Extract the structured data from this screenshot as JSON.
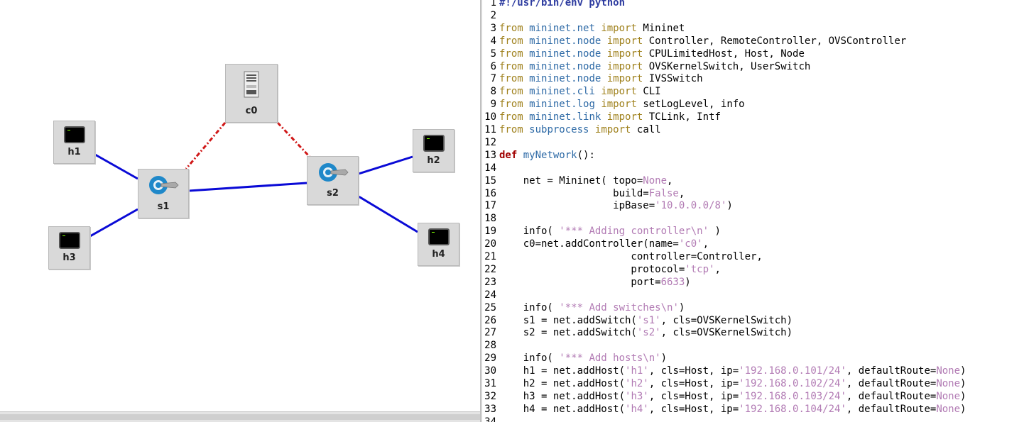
{
  "topology": {
    "nodes": [
      {
        "id": "h1",
        "label": "h1",
        "kind": "host",
        "icon": "terminal-icon"
      },
      {
        "id": "h2",
        "label": "h2",
        "kind": "host",
        "icon": "terminal-icon"
      },
      {
        "id": "h3",
        "label": "h3",
        "kind": "host",
        "icon": "terminal-icon"
      },
      {
        "id": "h4",
        "label": "h4",
        "kind": "host",
        "icon": "terminal-icon"
      },
      {
        "id": "s1",
        "label": "s1",
        "kind": "switch",
        "icon": "switch-icon"
      },
      {
        "id": "s2",
        "label": "s2",
        "kind": "switch",
        "icon": "switch-icon"
      },
      {
        "id": "c0",
        "label": "c0",
        "kind": "controller",
        "icon": "server-icon"
      }
    ],
    "links": [
      {
        "from": "h1",
        "to": "s1",
        "type": "data"
      },
      {
        "from": "h3",
        "to": "s1",
        "type": "data"
      },
      {
        "from": "s1",
        "to": "s2",
        "type": "data"
      },
      {
        "from": "s2",
        "to": "h2",
        "type": "data"
      },
      {
        "from": "s2",
        "to": "h4",
        "type": "data"
      },
      {
        "from": "c0",
        "to": "s1",
        "type": "control"
      },
      {
        "from": "c0",
        "to": "s2",
        "type": "control"
      }
    ],
    "colors": {
      "data_link": "#0a0ad6",
      "control_link": "#d01818",
      "node_bg": "#d9d9d9"
    }
  },
  "editor": {
    "colors": {
      "keyword": "#a0821e",
      "module": "#2e6aa6",
      "string": "#b27bb4",
      "def": "#a00000"
    },
    "lines": [
      {
        "n": "1",
        "t": [
          [
            "shebang",
            "#!/usr/bin/env python"
          ]
        ]
      },
      {
        "n": "2",
        "t": []
      },
      {
        "n": "3",
        "t": [
          [
            "kw",
            "from"
          ],
          [
            "",
            ""
          ],
          [
            "plain",
            " "
          ],
          [
            "mod",
            "mininet.net"
          ],
          [
            "plain",
            " "
          ],
          [
            "kw",
            "import"
          ],
          [
            "plain",
            " Mininet"
          ]
        ]
      },
      {
        "n": "4",
        "t": [
          [
            "kw",
            "from"
          ],
          [
            "plain",
            " "
          ],
          [
            "mod",
            "mininet.node"
          ],
          [
            "plain",
            " "
          ],
          [
            "kw",
            "import"
          ],
          [
            "plain",
            " Controller, RemoteController, OVSController"
          ]
        ]
      },
      {
        "n": "5",
        "t": [
          [
            "kw",
            "from"
          ],
          [
            "plain",
            " "
          ],
          [
            "mod",
            "mininet.node"
          ],
          [
            "plain",
            " "
          ],
          [
            "kw",
            "import"
          ],
          [
            "plain",
            " CPULimitedHost, Host, Node"
          ]
        ]
      },
      {
        "n": "6",
        "t": [
          [
            "kw",
            "from"
          ],
          [
            "plain",
            " "
          ],
          [
            "mod",
            "mininet.node"
          ],
          [
            "plain",
            " "
          ],
          [
            "kw",
            "import"
          ],
          [
            "plain",
            " OVSKernelSwitch, UserSwitch"
          ]
        ]
      },
      {
        "n": "7",
        "t": [
          [
            "kw",
            "from"
          ],
          [
            "plain",
            " "
          ],
          [
            "mod",
            "mininet.node"
          ],
          [
            "plain",
            " "
          ],
          [
            "kw",
            "import"
          ],
          [
            "plain",
            " IVSSwitch"
          ]
        ]
      },
      {
        "n": "8",
        "t": [
          [
            "kw",
            "from"
          ],
          [
            "plain",
            " "
          ],
          [
            "mod",
            "mininet.cli"
          ],
          [
            "plain",
            " "
          ],
          [
            "kw",
            "import"
          ],
          [
            "plain",
            " CLI"
          ]
        ]
      },
      {
        "n": "9",
        "t": [
          [
            "kw",
            "from"
          ],
          [
            "plain",
            " "
          ],
          [
            "mod",
            "mininet.log"
          ],
          [
            "plain",
            " "
          ],
          [
            "kw",
            "import"
          ],
          [
            "plain",
            " setLogLevel, info"
          ]
        ]
      },
      {
        "n": "10",
        "t": [
          [
            "kw",
            "from"
          ],
          [
            "plain",
            " "
          ],
          [
            "mod",
            "mininet.link"
          ],
          [
            "plain",
            " "
          ],
          [
            "kw",
            "import"
          ],
          [
            "plain",
            " TCLink, Intf"
          ]
        ]
      },
      {
        "n": "11",
        "t": [
          [
            "kw",
            "from"
          ],
          [
            "plain",
            " "
          ],
          [
            "mod",
            "subprocess"
          ],
          [
            "plain",
            " "
          ],
          [
            "kw",
            "import"
          ],
          [
            "plain",
            " call"
          ]
        ]
      },
      {
        "n": "12",
        "t": []
      },
      {
        "n": "13",
        "t": [
          [
            "def",
            "def"
          ],
          [
            "plain",
            " "
          ],
          [
            "fn",
            "myNetwork"
          ],
          [
            "plain",
            "():"
          ]
        ]
      },
      {
        "n": "14",
        "t": []
      },
      {
        "n": "15",
        "t": [
          [
            "plain",
            "    net = Mininet( topo="
          ],
          [
            "str",
            "None"
          ],
          [
            "plain",
            ","
          ]
        ]
      },
      {
        "n": "16",
        "t": [
          [
            "plain",
            "                   build="
          ],
          [
            "str",
            "False"
          ],
          [
            "plain",
            ","
          ]
        ]
      },
      {
        "n": "17",
        "t": [
          [
            "plain",
            "                   ipBase="
          ],
          [
            "str",
            "'10.0.0.0/8'"
          ],
          [
            "plain",
            ")"
          ]
        ]
      },
      {
        "n": "18",
        "t": []
      },
      {
        "n": "19",
        "t": [
          [
            "plain",
            "    info( "
          ],
          [
            "str",
            "'*** Adding controller\\n'"
          ],
          [
            "plain",
            " )"
          ]
        ]
      },
      {
        "n": "20",
        "t": [
          [
            "plain",
            "    c0=net.addController(name="
          ],
          [
            "str",
            "'c0'"
          ],
          [
            "plain",
            ","
          ]
        ]
      },
      {
        "n": "21",
        "t": [
          [
            "plain",
            "                      controller=Controller,"
          ]
        ]
      },
      {
        "n": "22",
        "t": [
          [
            "plain",
            "                      protocol="
          ],
          [
            "str",
            "'tcp'"
          ],
          [
            "plain",
            ","
          ]
        ]
      },
      {
        "n": "23",
        "t": [
          [
            "plain",
            "                      port="
          ],
          [
            "str",
            "6633"
          ],
          [
            "plain",
            ")"
          ]
        ]
      },
      {
        "n": "24",
        "t": []
      },
      {
        "n": "25",
        "t": [
          [
            "plain",
            "    info( "
          ],
          [
            "str",
            "'*** Add switches\\n'"
          ],
          [
            "plain",
            ")"
          ]
        ]
      },
      {
        "n": "26",
        "t": [
          [
            "plain",
            "    s1 = net.addSwitch("
          ],
          [
            "str",
            "'s1'"
          ],
          [
            "plain",
            ", cls=OVSKernelSwitch)"
          ]
        ]
      },
      {
        "n": "27",
        "t": [
          [
            "plain",
            "    s2 = net.addSwitch("
          ],
          [
            "str",
            "'s2'"
          ],
          [
            "plain",
            ", cls=OVSKernelSwitch)"
          ]
        ]
      },
      {
        "n": "28",
        "t": []
      },
      {
        "n": "29",
        "t": [
          [
            "plain",
            "    info( "
          ],
          [
            "str",
            "'*** Add hosts\\n'"
          ],
          [
            "plain",
            ")"
          ]
        ]
      },
      {
        "n": "30",
        "t": [
          [
            "plain",
            "    h1 = net.addHost("
          ],
          [
            "str",
            "'h1'"
          ],
          [
            "plain",
            ", cls=Host, ip="
          ],
          [
            "str",
            "'192.168.0.101/24'"
          ],
          [
            "plain",
            ", defaultRoute="
          ],
          [
            "str",
            "None"
          ],
          [
            "plain",
            ")"
          ]
        ]
      },
      {
        "n": "31",
        "t": [
          [
            "plain",
            "    h2 = net.addHost("
          ],
          [
            "str",
            "'h2'"
          ],
          [
            "plain",
            ", cls=Host, ip="
          ],
          [
            "str",
            "'192.168.0.102/24'"
          ],
          [
            "plain",
            ", defaultRoute="
          ],
          [
            "str",
            "None"
          ],
          [
            "plain",
            ")"
          ]
        ]
      },
      {
        "n": "32",
        "t": [
          [
            "plain",
            "    h3 = net.addHost("
          ],
          [
            "str",
            "'h3'"
          ],
          [
            "plain",
            ", cls=Host, ip="
          ],
          [
            "str",
            "'192.168.0.103/24'"
          ],
          [
            "plain",
            ", defaultRoute="
          ],
          [
            "str",
            "None"
          ],
          [
            "plain",
            ")"
          ]
        ]
      },
      {
        "n": "33",
        "t": [
          [
            "plain",
            "    h4 = net.addHost("
          ],
          [
            "str",
            "'h4'"
          ],
          [
            "plain",
            ", cls=Host, ip="
          ],
          [
            "str",
            "'192.168.0.104/24'"
          ],
          [
            "plain",
            ", defaultRoute="
          ],
          [
            "str",
            "None"
          ],
          [
            "plain",
            ")"
          ]
        ]
      },
      {
        "n": "34",
        "t": []
      }
    ]
  }
}
